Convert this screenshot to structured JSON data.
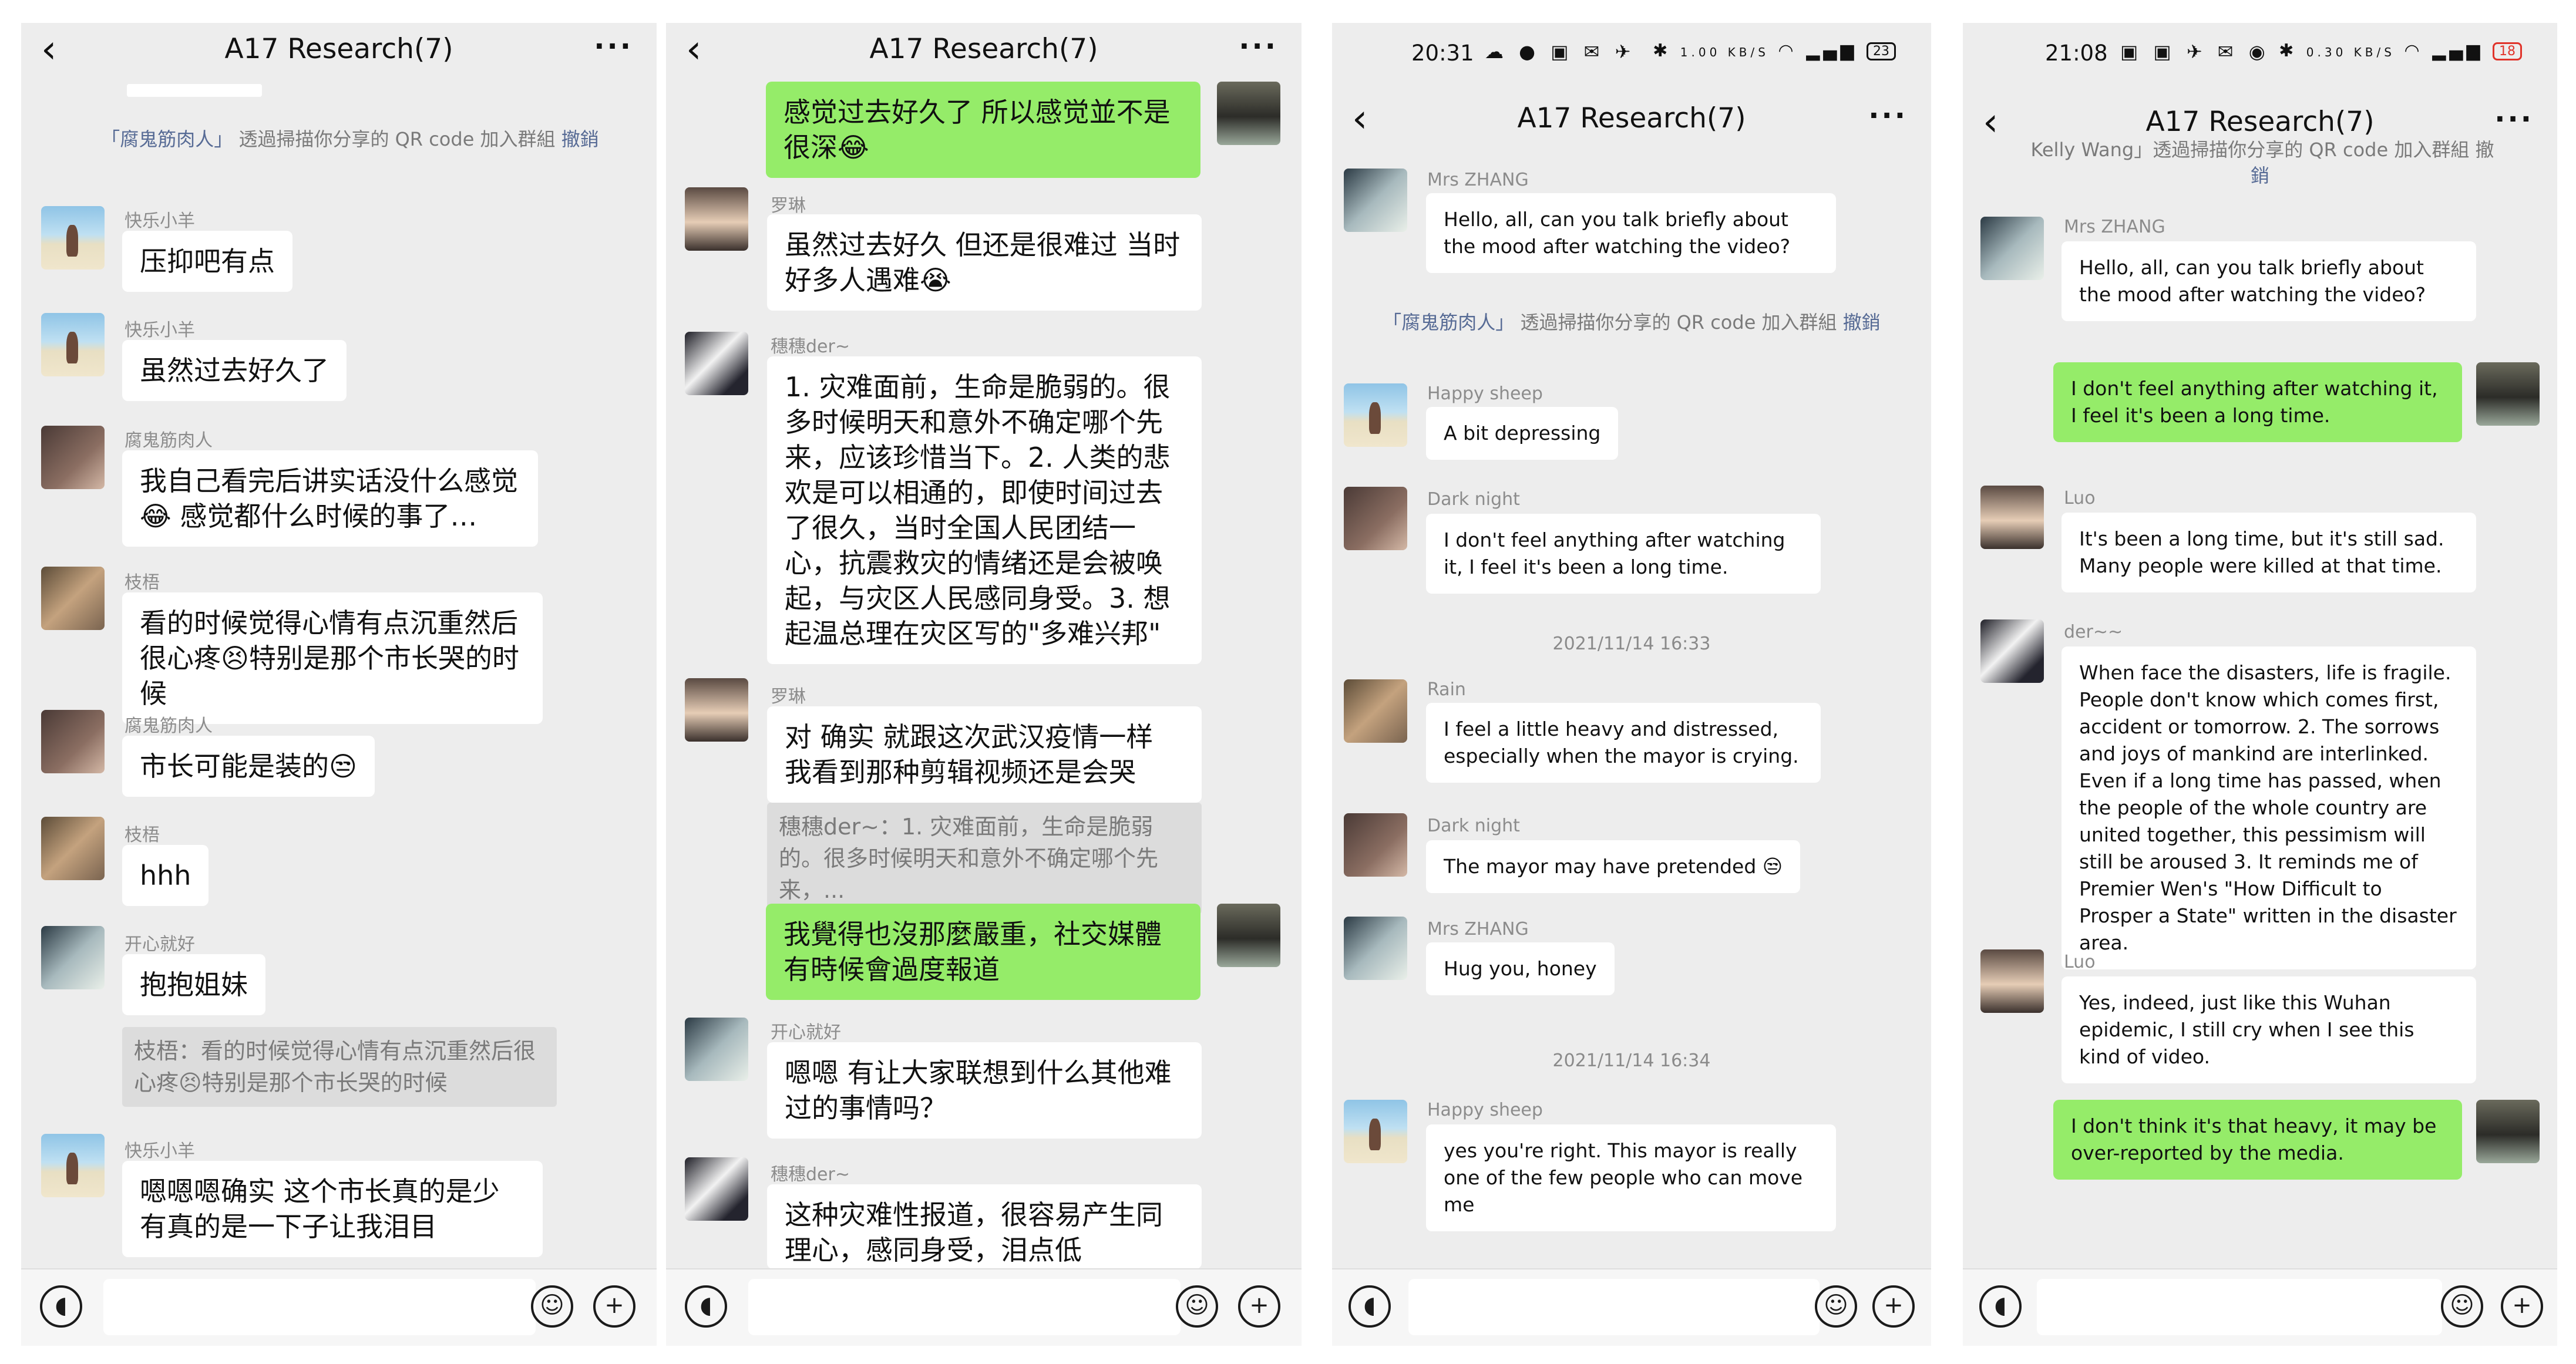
{
  "panels": [
    {
      "title": "A17 Research(7)",
      "system_msg": {
        "name": "「腐鬼筋肉人」",
        "text": "透過掃描你分享的 QR code 加入群組",
        "action": "撤銷"
      },
      "messages": [
        {
          "sender": "快乐小羊",
          "text": "压抑吧有点"
        },
        {
          "sender": "快乐小羊",
          "text": "虽然过去好久了"
        },
        {
          "sender": "腐鬼筋肉人",
          "text": "我自己看完后讲实话没什么感觉😂 感觉都什么时候的事了…"
        },
        {
          "sender": "枝梧",
          "text": "看的时候觉得心情有点沉重然后很心疼😣特别是那个市长哭的时候"
        },
        {
          "sender": "腐鬼筋肉人",
          "text": "市长可能是装的😒"
        },
        {
          "sender": "枝梧",
          "text": "hhh"
        },
        {
          "sender": "开心就好",
          "text": "抱抱姐妹",
          "quote": "枝梧：看的时候觉得心情有点沉重然后很心疼😣特别是那个市长哭的时候"
        },
        {
          "sender": "快乐小羊",
          "text": "嗯嗯嗯确实 这个市长真的是少有真的是一下子让我泪目"
        }
      ]
    },
    {
      "title": "A17 Research(7)",
      "messages": [
        {
          "sender": "",
          "text": "感觉过去好久了 所以感觉並不是很深😂"
        },
        {
          "sender": "罗琳",
          "text": "虽然过去好久 但还是很难过 当时好多人遇难😭"
        },
        {
          "sender": "穗穗der~",
          "text": "1. 灾难面前，生命是脆弱的。很多时候明天和意外不确定哪个先来，应该珍惜当下。2. 人类的悲欢是可以相通的，即使时间过去了很久，当时全国人民团结一心，抗震救灾的情绪还是会被唤起，与灾区人民感同身受。3. 想起温总理在灾区写的\"多难兴邦\""
        },
        {
          "sender": "罗琳",
          "text": "对 确实 就跟这次武汉疫情一样 我看到那种剪辑视频还是会哭",
          "quote": "穗穗der~：1. 灾难面前，生命是脆弱的。很多时候明天和意外不确定哪个先来，..."
        },
        {
          "sender": "",
          "text": "我覺得也沒那麼嚴重，社交媒體有時候會過度報道"
        },
        {
          "sender": "开心就好",
          "text": "嗯嗯 有让大家联想到什么其他难过的事情吗？"
        },
        {
          "sender": "穗穗der~",
          "text": "这种灾难性报道，很容易产生同理心，感同身受，泪点低"
        }
      ]
    },
    {
      "title": "A17 Research(7)",
      "time": "20:31",
      "net_speed": "1.00 KB/S",
      "battery": "23",
      "system_msg": {
        "name": "「腐鬼筋肉人」",
        "text": "透過掃描你分享的 QR code 加入群組",
        "action": "撤銷"
      },
      "timestamps": [
        "2021/11/14 16:33",
        "2021/11/14 16:34"
      ],
      "messages": [
        {
          "sender": "Mrs ZHANG",
          "text": "Hello, all, can you talk briefly about the mood after watching the video?"
        },
        {
          "sender": "Happy sheep",
          "text": "A bit depressing"
        },
        {
          "sender": "Dark night",
          "text": "I don't feel anything after watching it, I feel it's been a long time."
        },
        {
          "sender": "Rain",
          "text": "I feel a little heavy and distressed, especially when the mayor is crying."
        },
        {
          "sender": "Dark night",
          "text": "The mayor may have pretended 😒"
        },
        {
          "sender": "Mrs ZHANG",
          "text": "Hug you, honey"
        },
        {
          "sender": "Happy sheep",
          "text": "yes you're right. This mayor is really one of the few people who can move me"
        }
      ]
    },
    {
      "title": "A17 Research(7)",
      "time": "21:08",
      "net_speed": "0.30 KB/S",
      "battery": "18",
      "partial_top": "Kelly Wang」透過掃描你分享的 QR code 加入群組 撤",
      "partial_top2": "銷",
      "messages": [
        {
          "sender": "Mrs ZHANG",
          "text": "Hello, all, can you talk briefly about the mood after watching the video?"
        },
        {
          "sender": "",
          "text": "I don't feel anything after watching it,  I feel it's been a long time."
        },
        {
          "sender": "Luo",
          "text": "It's been a long time, but it's still sad. Many people were killed at that time."
        },
        {
          "sender": "der~~",
          "text": "When face the disasters, life is fragile. People don't know which comes first, accident or tomorrow. 2. The sorrows and joys of mankind are interlinked. Even if a long time has passed, when the people of the whole country are united together, this pessimism will still be aroused 3. It reminds me of Premier Wen's \"How Difficult to Prosper a State\" written in the disaster area."
        },
        {
          "sender": "Luo",
          "text": "Yes, indeed, just like this Wuhan epidemic, I still cry when I see this kind of video."
        },
        {
          "sender": "",
          "text": "I don't think it's that heavy, it may be over-reported by the media."
        }
      ]
    }
  ],
  "icons": {
    "back": "chevron-left-icon",
    "more": "more-dots-icon",
    "voice": "voice-icon",
    "emoji": "emoji-icon",
    "plus": "plus-icon"
  },
  "colors": {
    "panel_bg": "#ededed",
    "my_bubble": "#95ec69",
    "other_bubble": "#ffffff",
    "link": "#576b95"
  }
}
